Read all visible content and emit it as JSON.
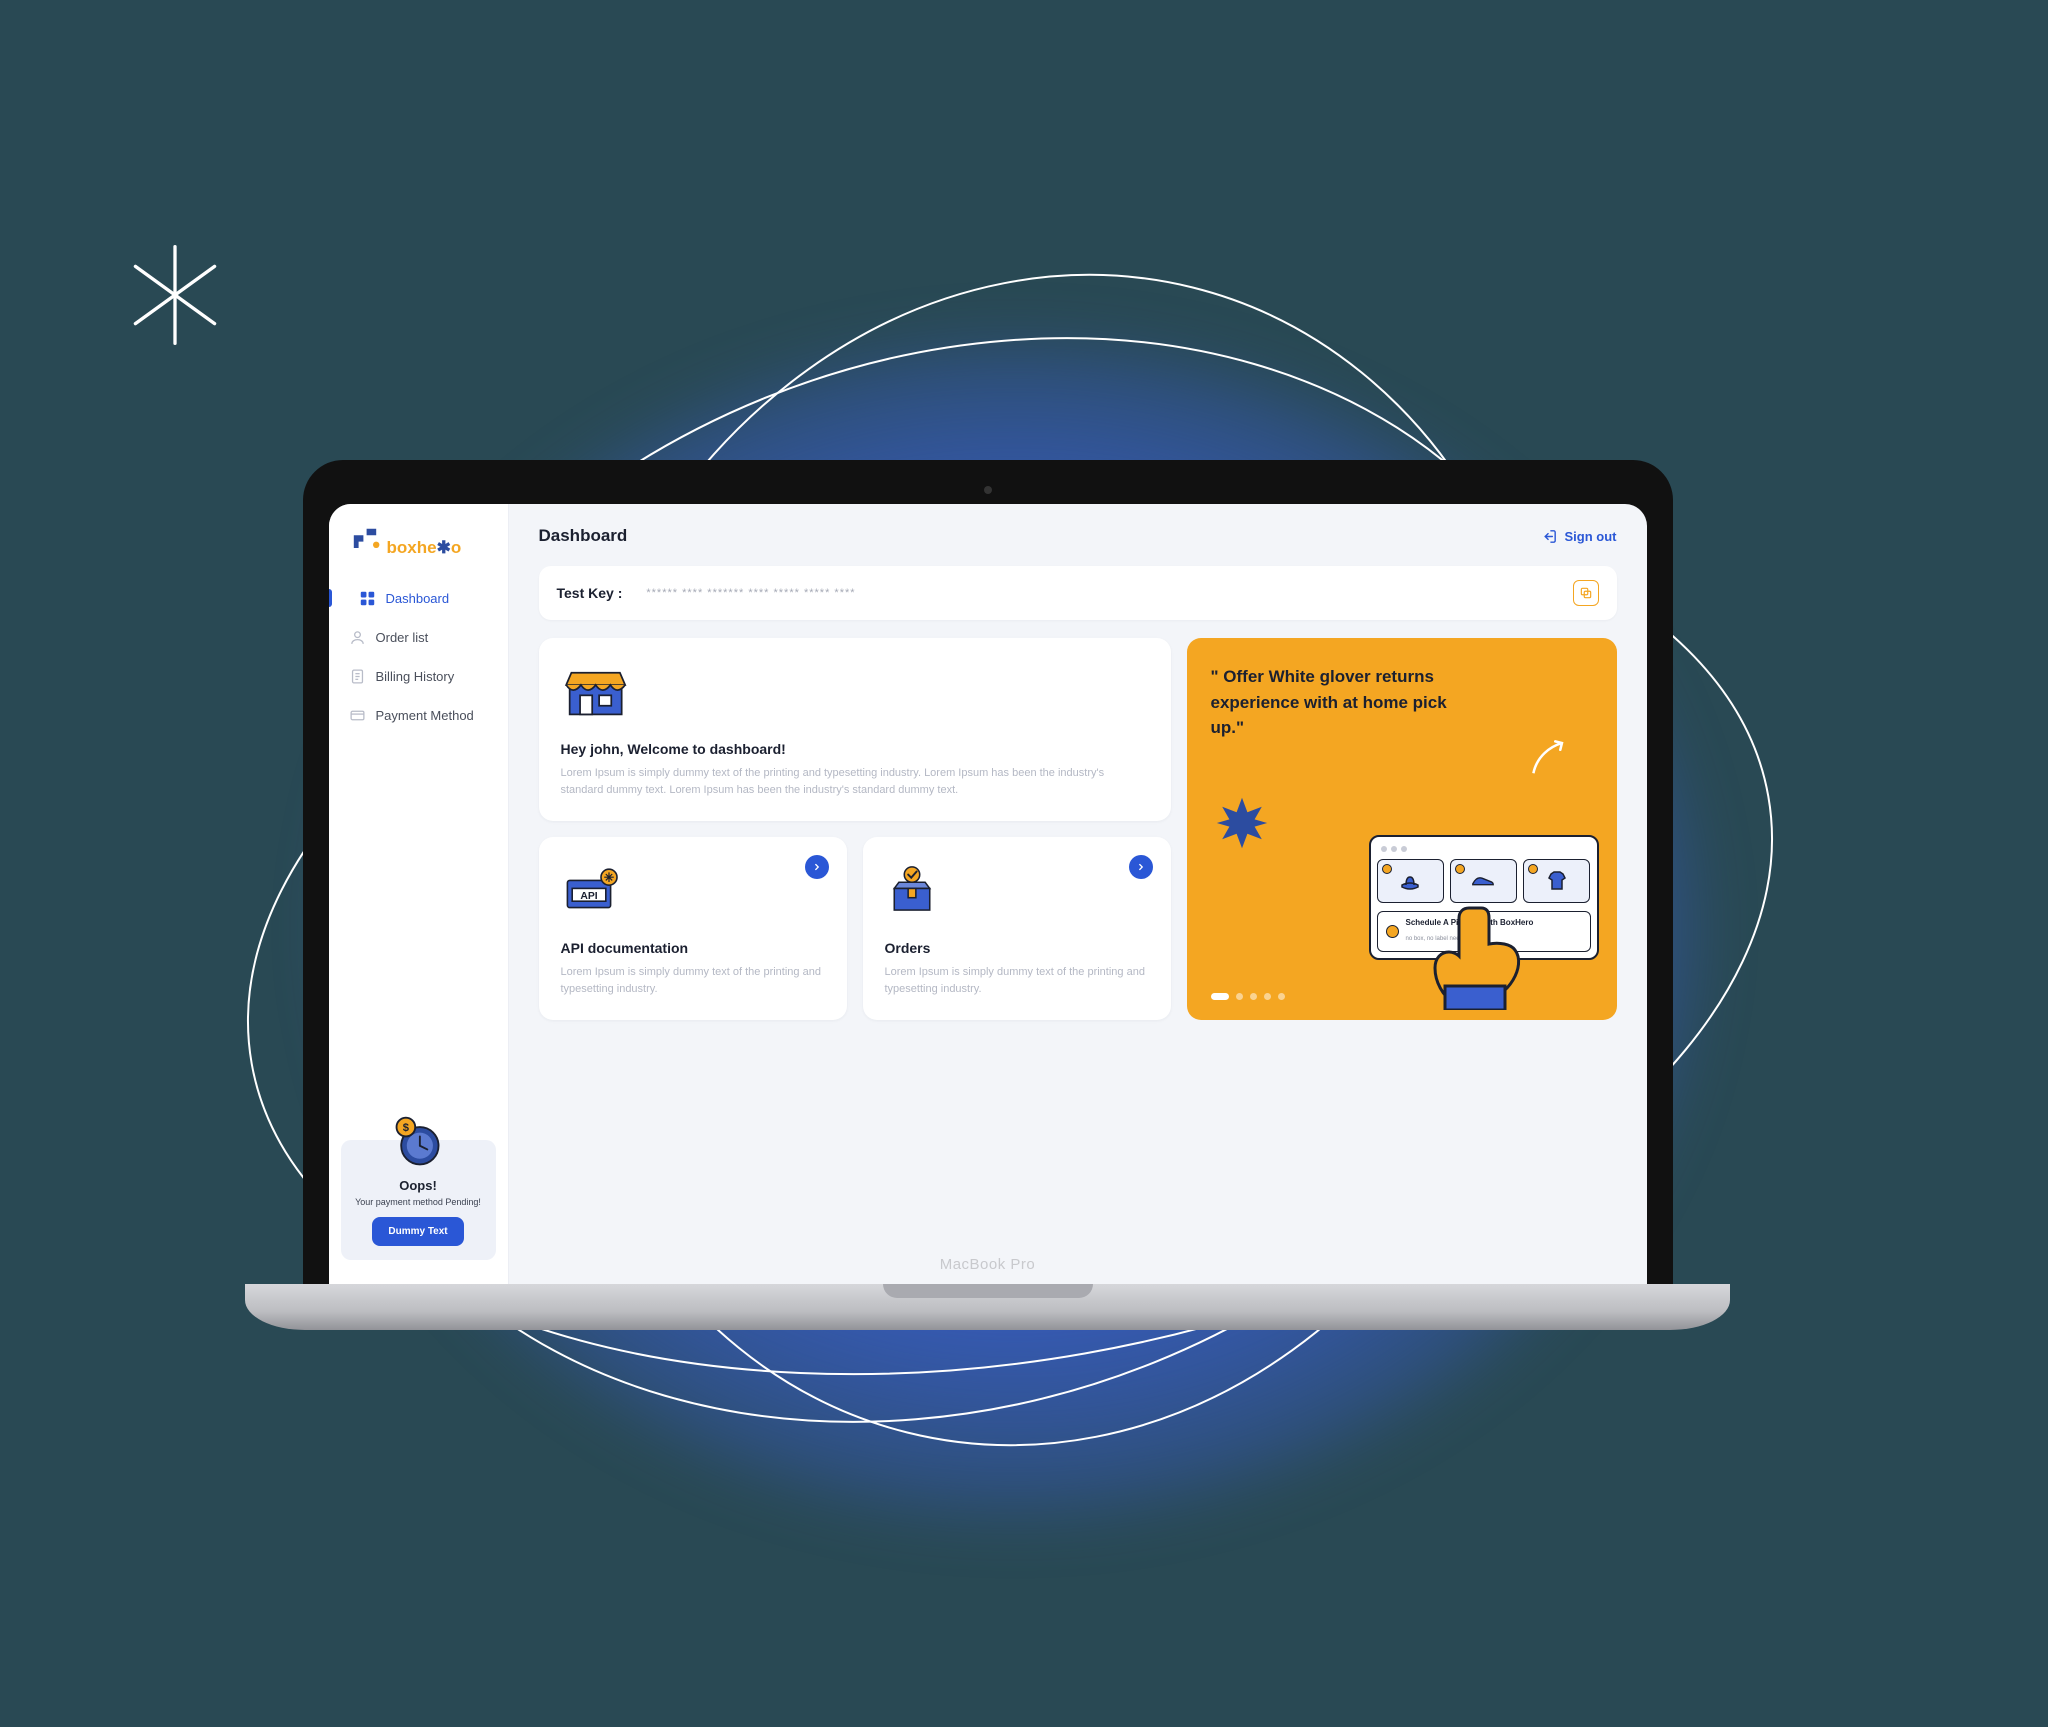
{
  "brand": {
    "name_a": "boxhe",
    "name_b": "o",
    "macbook": "MacBook Pro"
  },
  "header": {
    "title": "Dashboard",
    "signout": "Sign out"
  },
  "sidebar": {
    "items": [
      {
        "label": "Dashboard",
        "icon": "grid-icon",
        "active": true
      },
      {
        "label": "Order list",
        "icon": "user-icon"
      },
      {
        "label": "Billing History",
        "icon": "receipt-icon"
      },
      {
        "label": "Payment Method",
        "icon": "card-icon"
      }
    ],
    "alert": {
      "title": "Oops!",
      "subtitle": "Your payment method Pending!",
      "button": "Dummy Text"
    }
  },
  "testkey": {
    "label": "Test Key :",
    "masked": "****** **** ******* **** ***** ***** ****"
  },
  "welcome": {
    "title": "Hey john, Welcome to dashboard!",
    "body": "Lorem Ipsum is simply dummy text of the printing and typesetting industry. Lorem Ipsum has been the industry's standard dummy text. Lorem Ipsum has been the industry's standard dummy text."
  },
  "cards": [
    {
      "title": "API documentation",
      "body": "Lorem Ipsum is simply dummy text of the printing and typesetting industry."
    },
    {
      "title": "Orders",
      "body": "Lorem Ipsum is simply dummy text of the printing and typesetting industry."
    }
  ],
  "promo": {
    "quote": "\" Offer White glover returns experience with at home pick up.\"",
    "schedule_title": "Schedule A Pick-up with BoxHero",
    "schedule_sub": "no box, no label needed"
  },
  "colors": {
    "accent_blue": "#2a57d6",
    "accent_orange": "#f4a622",
    "bg_canvas": "#294954"
  }
}
